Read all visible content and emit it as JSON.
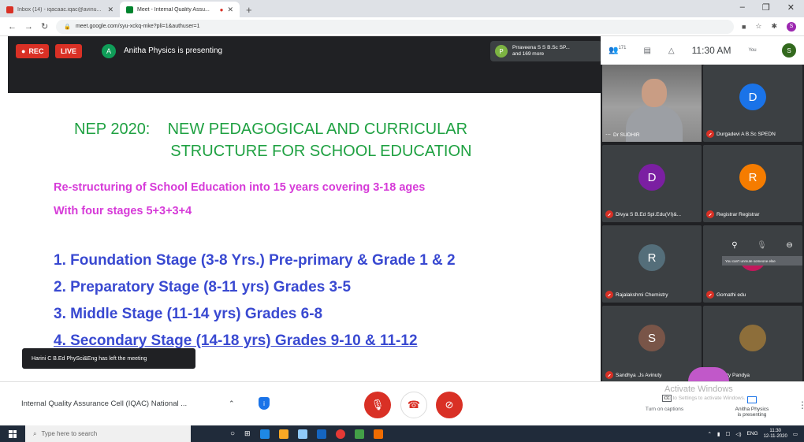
{
  "browser": {
    "tabs": [
      {
        "title": "Inbox (14) - iqacaac.iqac@avinu...",
        "color": "#d93025"
      },
      {
        "title": "Meet - Internal Quality Assu...",
        "color": "#00832d"
      }
    ],
    "new_tab": "+",
    "url": "meet.google.com/syu-xckq-mke?pli=1&authuser=1",
    "profile_initial": "S"
  },
  "meet": {
    "rec_label": "REC",
    "live_label": "LIVE",
    "presenter_initial": "A",
    "presenting_text": "Anitha Physics is presenting",
    "others_initial": "P",
    "others_line1": "Prraveena S S B.Sc SP...",
    "others_line2": "and 169 more",
    "participants_count": "171",
    "time": "11:30 AM",
    "you_label": "You",
    "you_initial": "S"
  },
  "slide": {
    "title": "NEP 2020:    NEW PEDAGOGICAL AND CURRICULAR\n                      STRUCTURE FOR SCHOOL EDUCATION",
    "subtitle1": "Re-structuring of School Education into 15 years covering 3-18 ages",
    "subtitle2": "With four stages 5+3+3+4",
    "items": [
      "1.  Foundation Stage (3-8 Yrs.) Pre-primary & Grade 1 & 2",
      "2.  Preparatory Stage (8-11 yrs) Grades 3-5",
      "3.  Middle Stage (11-14 yrs) Grades 6-8",
      "4.  Secondary Stage (14-18 yrs) Grades 9-10 & 11-12"
    ]
  },
  "toast": "Harini C B.Ed PhySci&Eng has left the meeting",
  "participants": [
    {
      "name": "Dr SUDHIR",
      "initial": "",
      "color": "#000000",
      "video": true
    },
    {
      "name": "Durgadevi A B.Sc SPEDN",
      "initial": "D",
      "color": "#1a73e8"
    },
    {
      "name": "Divya S B.Ed Spl.Edu(VI)&...",
      "initial": "D",
      "color": "#7b1fa2"
    },
    {
      "name": "Registrar Registrar",
      "initial": "R",
      "color": "#f57c00"
    },
    {
      "name": "Rajalakshmi Chemistry",
      "initial": "R",
      "color": "#546e7a"
    },
    {
      "name": "Gomathi edu",
      "initial": "",
      "color": "#c2185b"
    },
    {
      "name": "Sandhya .Js Avinuty",
      "initial": "S",
      "color": "#795548"
    },
    {
      "name": "Trupty Pandya",
      "initial": "",
      "color": "#8d6e3a"
    }
  ],
  "tile_tooltip": "You can't unmute someone else",
  "bottom": {
    "meeting_name": "Internal Quality Assurance Cell (IQAC) National ...",
    "captions_label": "Turn on captions",
    "presenting_card_line1": "Anitha Physics",
    "presenting_card_line2": "is presenting",
    "activate_title": "Activate Windows",
    "activate_sub": "Go to Settings to activate Windows."
  },
  "taskbar": {
    "search_placeholder": "Type here to search",
    "lang": "ENG",
    "time": "11:30",
    "date": "12-11-2020"
  },
  "colors": {
    "accent_red": "#d93025",
    "meet_dark": "#202124",
    "slide_title": "#1fa142",
    "slide_subtitle": "#d63ad8",
    "slide_items": "#3949d1"
  }
}
